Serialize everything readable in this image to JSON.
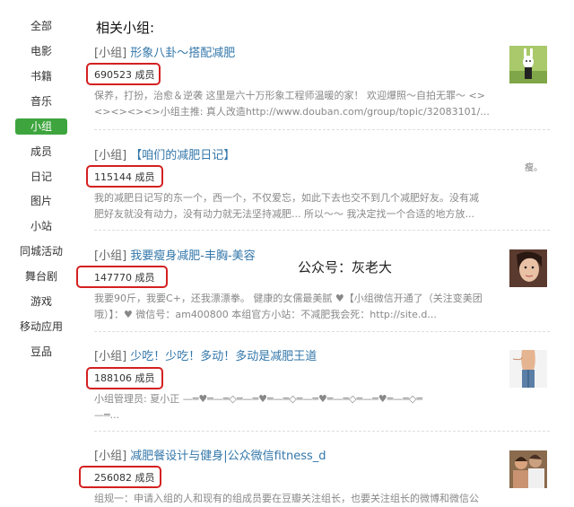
{
  "sidebar": {
    "items": [
      {
        "label": "全部"
      },
      {
        "label": "电影"
      },
      {
        "label": "书籍"
      },
      {
        "label": "音乐"
      },
      {
        "label": "小组",
        "active": true
      },
      {
        "label": "成员"
      },
      {
        "label": "日记"
      },
      {
        "label": "图片"
      },
      {
        "label": "小站"
      },
      {
        "label": "同城活动"
      },
      {
        "label": "舞台剧"
      },
      {
        "label": "游戏"
      },
      {
        "label": "移动应用"
      },
      {
        "label": "豆品"
      }
    ]
  },
  "main": {
    "section_title": "相关小组:",
    "watermark": "公众号：灰老大",
    "groups": [
      {
        "prefix": "[小组]",
        "name": "形象八卦～搭配减肥",
        "members": "690523 成员",
        "desc_line1": "保养，打扮，治愈＆逆袭 这里是六十万形象工程师温暖的家！ 欢迎爆照～自拍无罪～ <>",
        "desc_line2": "<><><><>小组主推: 真人改造http://www.douban.com/group/topic/32083101/..."
      },
      {
        "prefix": "[小组]",
        "name": "【咱们的减肥日记】",
        "members": "115144 成员",
        "desc_line1": "我的减肥日记写的东一个，西一个，不仅爱忘，如此下去也交不到几个减肥好友。没有减",
        "desc_line2": "肥好友就没有动力，没有动力就无法坚持减肥... 所以～～ 我决定找一个合适的地方放...",
        "note": "瘦。"
      },
      {
        "prefix": "[小组]",
        "name": "我要瘦身减肥-丰胸-美容",
        "members": "147770 成员",
        "desc_line1": "我要90斤，我要C+，还我漂漂拳。 健康的女儒最美腻 ♥【小组微信开通了（关注变美团",
        "desc_line2": "哦）】：♥ 微信号：am400800 本组官方小站：不减肥我会死：http://site.d..."
      },
      {
        "prefix": "[小组]",
        "name": "少吃！少吃！多动！多动是减肥王道",
        "members": "188106 成员",
        "desc_line1": "小组管理员: 夏小正 —═♥═—═◇═—═♥═—═◇═—═♥═—═◇═—═♥═—═◇═",
        "desc_line2": "—═..."
      },
      {
        "prefix": "[小组]",
        "name": "减肥餐设计与健身|公众微信fitness_d",
        "members": "256082 成员",
        "desc_line1": "组规一：申请入组的人和现有的组成员要在豆瓣关注组长，也要关注组长的微博和微信公",
        "desc_line2": ""
      }
    ]
  }
}
